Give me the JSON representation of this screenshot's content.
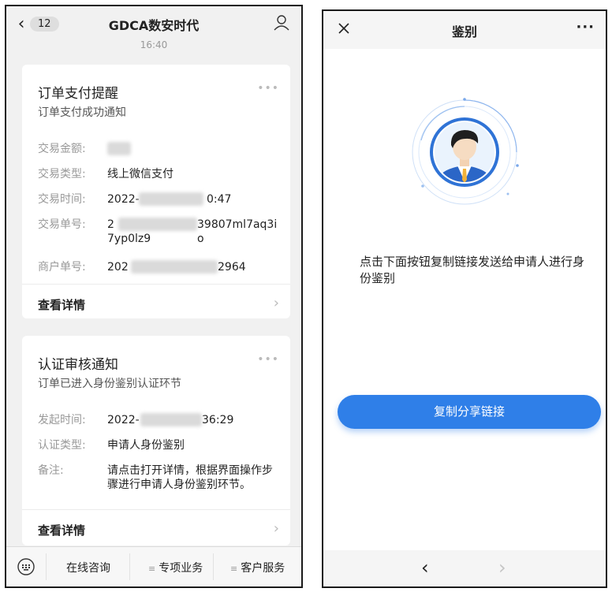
{
  "left": {
    "header": {
      "back_badge": "12",
      "title": "GDCA数安时代",
      "timestamp_partial": "16:40"
    },
    "card1": {
      "title": "订单支付提醒",
      "subtitle": "订单支付成功通知",
      "rows": [
        {
          "label": "交易金额:",
          "value": ""
        },
        {
          "label": "交易类型:",
          "value": "线上微信支付"
        },
        {
          "label": "交易时间:",
          "value_start": "2022-",
          "value_end": "0:47"
        },
        {
          "label": "交易单号:",
          "value_start": "2",
          "value_end": "39807ml7aq3io",
          "value_line2": "7yp0lz9"
        },
        {
          "label": "商户单号:",
          "value_start": "202",
          "value_end": "2964"
        }
      ],
      "details": "查看详情"
    },
    "card2": {
      "title": "认证审核通知",
      "subtitle": "订单已进入身份鉴别认证环节",
      "rows": [
        {
          "label": "发起时间:",
          "value_start": "2022-",
          "value_end": "36:29"
        },
        {
          "label": "认证类型:",
          "value": "申请人身份鉴别"
        },
        {
          "label": "备注:",
          "value": "请点击打开详情，根据界面操作步骤进行申请人身份鉴别环节。"
        }
      ],
      "details": "查看详情"
    },
    "bottom_menu": [
      "在线咨询",
      "专项业务",
      "客户服务"
    ]
  },
  "right": {
    "header": {
      "title": "鉴别",
      "more": "···"
    },
    "instruction": "点击下面按钮复制链接发送给申请人进行身份鉴别",
    "copy_button": "复制分享链接",
    "nav": {
      "back": "‹",
      "forward": "›"
    }
  },
  "colors": {
    "accent_blue": "#2f7fe8",
    "avatar_ring": "#2f73d6",
    "left_bg": "#f1f1f1"
  }
}
